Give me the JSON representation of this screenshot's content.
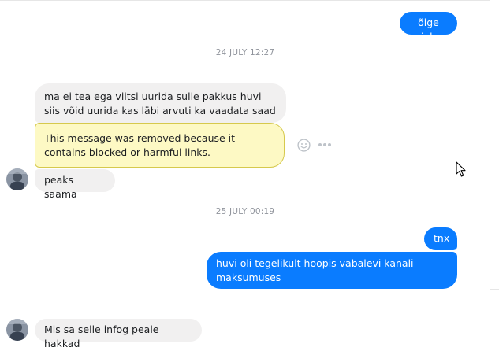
{
  "messages": {
    "m1": "õige jah",
    "ts1": "24 JULY 12:27",
    "m2": "ma ei tea ega viitsi uurida sulle pakkus huvi siis võid uurida kas läbi arvuti ka vaadata saad",
    "removed": "This message was removed because it contains blocked or harmful links.",
    "m3": "peaks saama",
    "ts2": "25 JULY 00:19",
    "m4": "tnx",
    "m5": "huvi oli tegelikult hoopis vabalevi kanali maksumuses",
    "m6": "Mis sa selle infog peale hakkad"
  },
  "icons": {
    "react": "smiley-icon",
    "more": "more-dots-icon",
    "cursor": "mouse-pointer-icon"
  },
  "colors": {
    "outgoing": "#0a7cff",
    "incoming": "#f1f0f0",
    "removed_bg": "#fdf9c4",
    "removed_border": "#d6c94d",
    "timestamp": "#90949c"
  }
}
